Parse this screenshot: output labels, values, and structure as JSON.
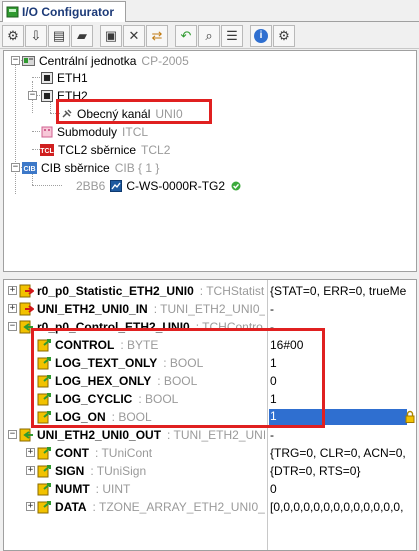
{
  "window": {
    "tab_title": "I/O Configurator"
  },
  "toolbar": {
    "buttons": [
      {
        "icon": "gear-icon",
        "glyph": "⚙"
      },
      {
        "icon": "download-icon",
        "glyph": "⇩"
      },
      {
        "icon": "print-icon",
        "glyph": "▤"
      },
      {
        "icon": "open-folder-icon",
        "glyph": "▰"
      },
      {
        "icon": "save-icon",
        "glyph": "▣"
      },
      {
        "icon": "tools-icon",
        "glyph": "✕"
      },
      {
        "icon": "swap-icon",
        "glyph": "⇄"
      },
      {
        "icon": "undo-icon",
        "glyph": "↶"
      },
      {
        "icon": "search-icon",
        "glyph": "⌕"
      },
      {
        "icon": "list-icon",
        "glyph": "☰"
      },
      {
        "icon": "info-icon",
        "glyph": "i"
      },
      {
        "icon": "settings-icon",
        "glyph": "⚙"
      }
    ]
  },
  "tree": {
    "root": {
      "label": "Centrální jednotka",
      "sub": "CP-2005"
    },
    "eth1": {
      "label": "ETH1"
    },
    "eth2": {
      "label": "ETH2"
    },
    "channel": {
      "label": "Obecný kanál",
      "sub": "UNI0"
    },
    "submodules": {
      "label": "Submoduly",
      "sub": "ITCL"
    },
    "tcl2": {
      "label": "TCL2 sběrnice",
      "sub": "TCL2",
      "badge": "TCL"
    },
    "cib": {
      "label": "CIB sběrnice",
      "sub": "CIB { 1 }",
      "badge": "CIB"
    },
    "module": {
      "addr": "2BB6",
      "label": "C-WS-0000R-TG2"
    }
  },
  "grid": {
    "rows": [
      {
        "name": "r0_p0_Statistic_ETH2_UNI0",
        "type": ": TCHStatist",
        "value": "{STAT=0, ERR=0, trueMe"
      },
      {
        "name": "UNI_ETH2_UNI0_IN",
        "type": ": TUNI_ETH2_UNI0_IN",
        "value": "-"
      },
      {
        "name": "r0_p0_Control_ETH2_UNI0",
        "type": ": TCHContro",
        "value": "-"
      },
      {
        "name": "CONTROL",
        "type": ": BYTE",
        "value": "16#00"
      },
      {
        "name": "LOG_TEXT_ONLY",
        "type": ": BOOL",
        "value": "1"
      },
      {
        "name": "LOG_HEX_ONLY",
        "type": ": BOOL",
        "value": "0"
      },
      {
        "name": "LOG_CYCLIC",
        "type": ": BOOL",
        "value": "1"
      },
      {
        "name": "LOG_ON",
        "type": ": BOOL",
        "value": "1"
      },
      {
        "name": "UNI_ETH2_UNI0_OUT",
        "type": ": TUNI_ETH2_UNI",
        "value": "-"
      },
      {
        "name": "CONT",
        "type": ": TUniCont",
        "value": "{TRG=0, CLR=0, ACN=0,"
      },
      {
        "name": "SIGN",
        "type": ": TUniSign",
        "value": "{DTR=0, RTS=0}"
      },
      {
        "name": "NUMT",
        "type": ": UINT",
        "value": "0"
      },
      {
        "name": "DATA",
        "type": ": TZONE_ARRAY_ETH2_UNI0_T",
        "value": "[0,0,0,0,0,0,0,0,0,0,0,0,0,"
      }
    ]
  },
  "colors": {
    "highlight": "#e02020",
    "selection": "#2f6fd0",
    "title": "#1c3a78"
  }
}
